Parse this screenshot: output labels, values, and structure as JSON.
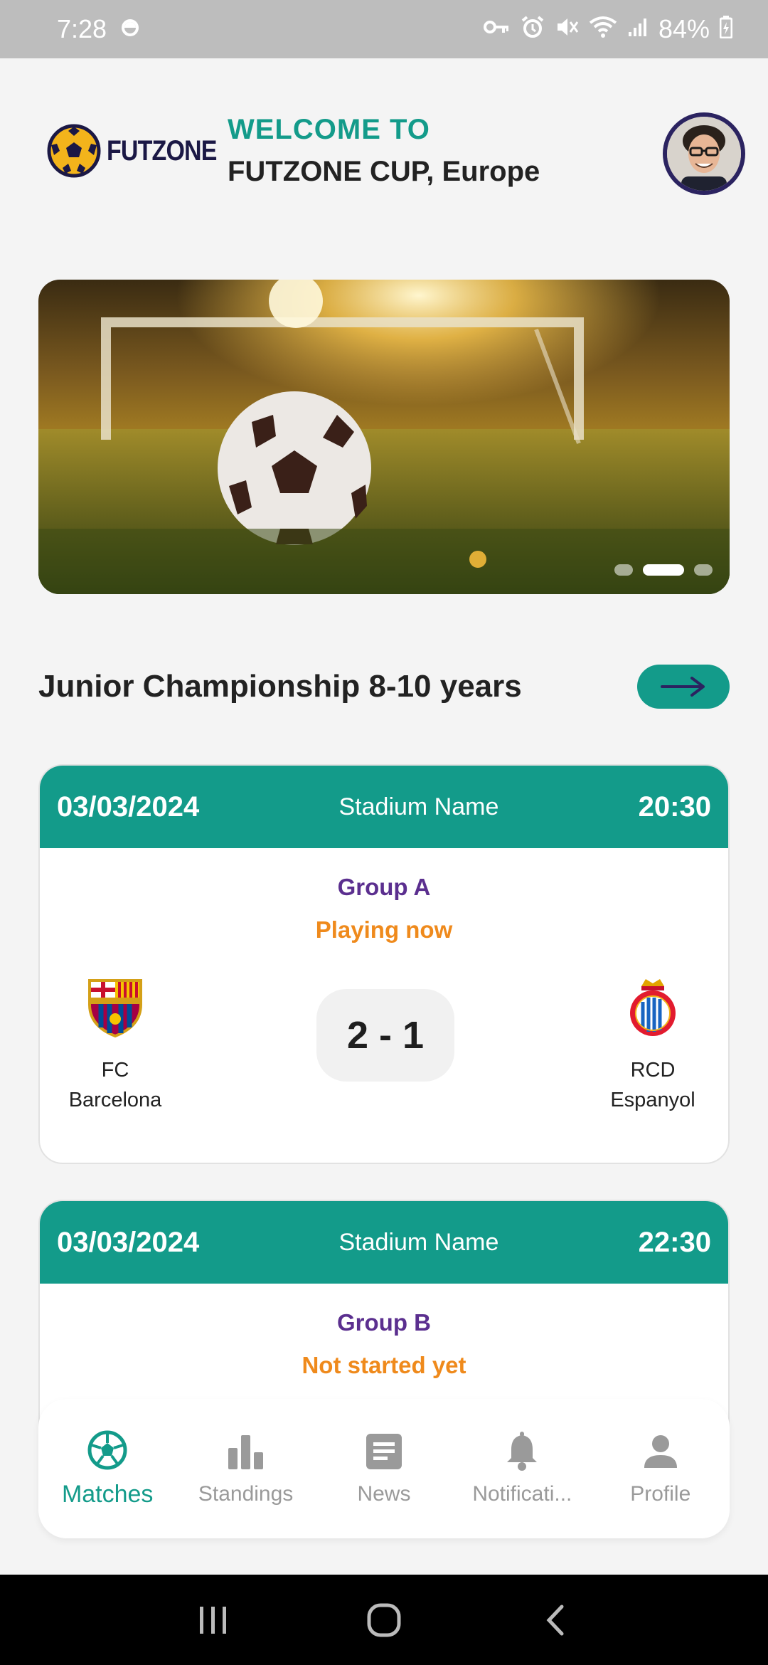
{
  "status_bar": {
    "time": "7:28",
    "battery": "84%",
    "icons": [
      "vpn-key-icon",
      "alarm-icon",
      "mute-icon",
      "wifi-icon",
      "signal-icon",
      "battery-charging-icon"
    ]
  },
  "header": {
    "logo_text": "FUTZONE",
    "welcome_line1": "WELCOME TO",
    "welcome_line2": "FUTZONE CUP, Europe"
  },
  "banner": {
    "slides_count": 3,
    "active_slide": 2
  },
  "section": {
    "title": "Junior Championship 8-10 years"
  },
  "matches": [
    {
      "date": "03/03/2024",
      "stadium": "Stadium Name",
      "time": "20:30",
      "group": "Group A",
      "status": "Playing now",
      "home_line1": "FC",
      "home_line2": "Barcelona",
      "away_line1": "RCD",
      "away_line2": "Espanyol",
      "score": "2 - 1"
    },
    {
      "date": "03/03/2024",
      "stadium": "Stadium Name",
      "time": "22:30",
      "group": "Group B",
      "status": "Not started yet"
    }
  ],
  "nav": {
    "items": [
      {
        "label": "Matches",
        "icon": "soccer-ball-icon",
        "active": true
      },
      {
        "label": "Standings",
        "icon": "bar-chart-icon"
      },
      {
        "label": "News",
        "icon": "news-icon"
      },
      {
        "label": "Notificati...",
        "icon": "bell-icon"
      },
      {
        "label": "Profile",
        "icon": "person-icon"
      }
    ]
  },
  "colors": {
    "accent": "#139b8a",
    "group": "#5b2f8f",
    "status": "#ef8a1c",
    "navy": "#1b1845"
  }
}
